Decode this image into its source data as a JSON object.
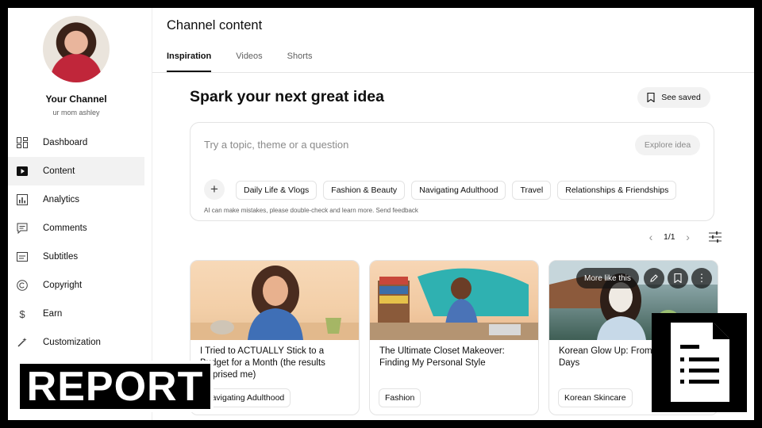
{
  "sidebar": {
    "channel_name": "Your Channel",
    "channel_handle": "ur mom ashley",
    "items": [
      {
        "label": "Dashboard",
        "icon": "dashboard-icon",
        "active": false
      },
      {
        "label": "Content",
        "icon": "content-icon",
        "active": true
      },
      {
        "label": "Analytics",
        "icon": "analytics-icon",
        "active": false
      },
      {
        "label": "Comments",
        "icon": "comments-icon",
        "active": false
      },
      {
        "label": "Subtitles",
        "icon": "subtitles-icon",
        "active": false
      },
      {
        "label": "Copyright",
        "icon": "copyright-icon",
        "active": false
      },
      {
        "label": "Earn",
        "icon": "dollar-icon",
        "active": false
      },
      {
        "label": "Customization",
        "icon": "wand-icon",
        "active": false
      }
    ]
  },
  "header": {
    "title": "Channel content",
    "tabs": [
      {
        "label": "Inspiration",
        "active": true
      },
      {
        "label": "Videos",
        "active": false
      },
      {
        "label": "Shorts",
        "active": false
      }
    ]
  },
  "inspiration": {
    "heading": "Spark your next great idea",
    "see_saved_label": "See saved",
    "search_placeholder": "Try a topic, theme or a question",
    "explore_label": "Explore idea",
    "chips": [
      "Daily Life & Vlogs",
      "Fashion & Beauty",
      "Navigating Adulthood",
      "Travel",
      "Relationships & Friendships"
    ],
    "disclaimer": "AI can make mistakes, please double-check and learn more. Send feedback",
    "pager": {
      "current": "1/1"
    }
  },
  "cards": [
    {
      "title": "I Tried to ACTUALLY Stick to a Budget for a Month (the results surprised me)",
      "tag": "Navigating Adulthood"
    },
    {
      "title": "The Ultimate Closet Makeover: Finding My Personal Style",
      "tag": "Fashion"
    },
    {
      "title": "Korean Glow Up: From Radiant in 30 Days",
      "tag": "Korean Skincare",
      "overlay": {
        "more_like_this": "More like this"
      }
    }
  ],
  "overlay_badge": {
    "text": "REPORT"
  },
  "colors": {
    "accent": "#0f0f0f",
    "chip_bg": "#f2f2f2",
    "active_nav_bg": "#f2f2f2"
  }
}
